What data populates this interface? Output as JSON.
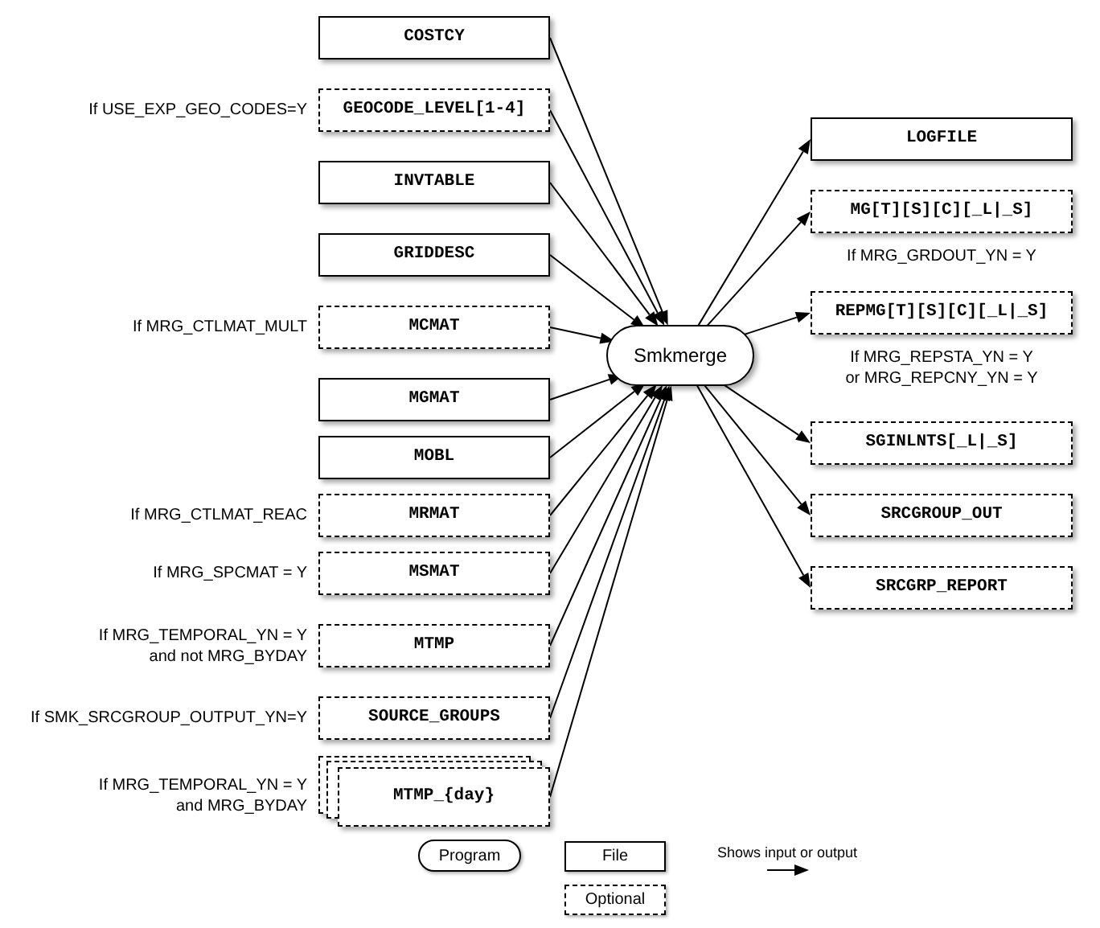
{
  "inputs": [
    {
      "label": "COSTCY",
      "optional": false,
      "stacked": false
    },
    {
      "label": "GEOCODE_LEVEL[1-4]",
      "optional": true,
      "stacked": false,
      "condition": [
        "If USE_EXP_GEO_CODES=Y"
      ]
    },
    {
      "label": "INVTABLE",
      "optional": false,
      "stacked": false
    },
    {
      "label": "GRIDDESC",
      "optional": false,
      "stacked": false
    },
    {
      "label": "MCMAT",
      "optional": true,
      "stacked": false,
      "condition": [
        "If MRG_CTLMAT_MULT"
      ]
    },
    {
      "label": "MGMAT",
      "optional": false,
      "stacked": false
    },
    {
      "label": "MOBL",
      "optional": false,
      "stacked": false
    },
    {
      "label": "MRMAT",
      "optional": true,
      "stacked": false,
      "condition": [
        "If MRG_CTLMAT_REAC"
      ]
    },
    {
      "label": "MSMAT",
      "optional": true,
      "stacked": false,
      "condition": [
        "If MRG_SPCMAT = Y"
      ]
    },
    {
      "label": "MTMP",
      "optional": true,
      "stacked": false,
      "condition": [
        "If MRG_TEMPORAL_YN = Y",
        "and not MRG_BYDAY"
      ]
    },
    {
      "label": "SOURCE_GROUPS",
      "optional": true,
      "stacked": false,
      "condition": [
        "If SMK_SRCGROUP_OUTPUT_YN=Y"
      ]
    },
    {
      "label": "MTMP_{day}",
      "optional": true,
      "stacked": true,
      "condition": [
        "If MRG_TEMPORAL_YN = Y",
        "and MRG_BYDAY"
      ]
    }
  ],
  "program": {
    "label": "Smkmerge"
  },
  "outputs": [
    {
      "label": "LOGFILE",
      "optional": false
    },
    {
      "label": "MG[T][S][C][_L|_S]",
      "optional": true,
      "condition": [
        "If MRG_GRDOUT_YN = Y"
      ]
    },
    {
      "label": "REPMG[T][S][C][_L|_S]",
      "optional": true,
      "condition": [
        "If MRG_REPSTA_YN = Y",
        "or MRG_REPCNY_YN = Y"
      ]
    },
    {
      "label": "SGINLNTS[_L|_S]",
      "optional": true
    },
    {
      "label": "SRCGROUP_OUT",
      "optional": true
    },
    {
      "label": "SRCGRP_REPORT",
      "optional": true
    }
  ],
  "legend": {
    "program": "Program",
    "file": "File",
    "optional": "Optional",
    "arrow": "Shows input or output"
  }
}
